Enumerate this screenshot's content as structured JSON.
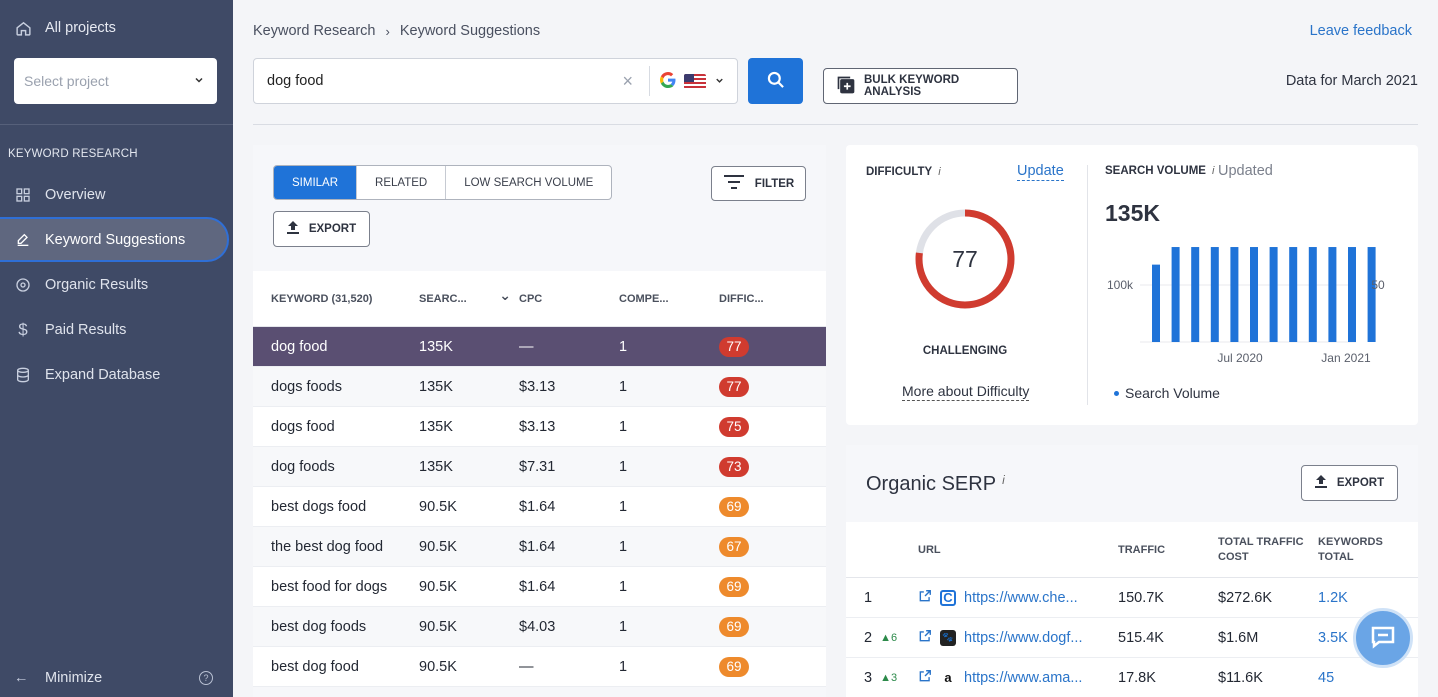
{
  "sidebar": {
    "all_projects": "All projects",
    "select_project_placeholder": "Select project",
    "section_title": "KEYWORD RESEARCH",
    "items": [
      {
        "label": "Overview",
        "icon": "grid-icon"
      },
      {
        "label": "Keyword Suggestions",
        "icon": "pencil-icon",
        "active": true
      },
      {
        "label": "Organic Results",
        "icon": "target-icon"
      },
      {
        "label": "Paid Results",
        "icon": "dollar-icon"
      },
      {
        "label": "Expand Database",
        "icon": "database-icon"
      }
    ],
    "minimize": "Minimize"
  },
  "header": {
    "breadcrumb": [
      "Keyword Research",
      "Keyword Suggestions"
    ],
    "feedback": "Leave feedback",
    "search_value": "dog food",
    "bulk_label": "BULK KEYWORD ANALYSIS",
    "data_for": "Data for March 2021"
  },
  "keywords": {
    "tabs": [
      "SIMILAR",
      "RELATED",
      "LOW SEARCH VOLUME"
    ],
    "filter_label": "FILTER",
    "export_label": "EXPORT",
    "columns": {
      "keyword": "KEYWORD  (31,520)",
      "search": "SEARC...",
      "cpc": "CPC",
      "competition": "COMPE...",
      "difficulty": "DIFFIC..."
    },
    "rows": [
      {
        "keyword": "dog food",
        "search": "135K",
        "cpc": "—",
        "competition": "1",
        "difficulty": "77"
      },
      {
        "keyword": "dogs foods",
        "search": "135K",
        "cpc": "$3.13",
        "competition": "1",
        "difficulty": "77"
      },
      {
        "keyword": "dogs food",
        "search": "135K",
        "cpc": "$3.13",
        "competition": "1",
        "difficulty": "75"
      },
      {
        "keyword": "dog foods",
        "search": "135K",
        "cpc": "$7.31",
        "competition": "1",
        "difficulty": "73"
      },
      {
        "keyword": "best dogs food",
        "search": "90.5K",
        "cpc": "$1.64",
        "competition": "1",
        "difficulty": "69"
      },
      {
        "keyword": "the best dog food",
        "search": "90.5K",
        "cpc": "$1.64",
        "competition": "1",
        "difficulty": "67"
      },
      {
        "keyword": "best food for dogs",
        "search": "90.5K",
        "cpc": "$1.64",
        "competition": "1",
        "difficulty": "69"
      },
      {
        "keyword": "best dog foods",
        "search": "90.5K",
        "cpc": "$4.03",
        "competition": "1",
        "difficulty": "69"
      },
      {
        "keyword": "best dog food",
        "search": "90.5K",
        "cpc": "—",
        "competition": "1",
        "difficulty": "69"
      }
    ]
  },
  "difficulty": {
    "title": "DIFFICULTY",
    "info": "i",
    "update": "Update",
    "value": "77",
    "score": 77,
    "label": "CHALLENGING",
    "more": "More about Difficulty",
    "color": "#d03b2f"
  },
  "search_volume": {
    "title": "SEARCH VOLUME",
    "info": "i",
    "updated": "Updated",
    "value": "135K",
    "legend": "Search Volume"
  },
  "chart_data": {
    "type": "bar",
    "values": [
      110,
      135,
      135,
      135,
      135,
      135,
      135,
      135,
      135,
      135,
      135,
      135
    ],
    "y_left_label": "100k",
    "y_right_label": "50",
    "x_tick_labels": [
      "Jul 2020",
      "Jan 2021"
    ],
    "legend": "Search Volume",
    "color": "#1f73d8"
  },
  "serp": {
    "title": "Organic SERP",
    "info": "i",
    "export_label": "EXPORT",
    "columns": {
      "url": "URL",
      "traffic": "TRAFFIC",
      "cost": "TOTAL TRAFFIC COST",
      "keywords": "KEYWORDS TOTAL"
    },
    "rows": [
      {
        "pos": "1",
        "delta": "",
        "url": "https://www.che...",
        "traffic": "150.7K",
        "cost": "$272.6K",
        "keywords": "1.2K"
      },
      {
        "pos": "2",
        "delta": "▲6",
        "url": "https://www.dogf...",
        "traffic": "515.4K",
        "cost": "$1.6M",
        "keywords": "3.5K"
      },
      {
        "pos": "3",
        "delta": "▲3",
        "url": "https://www.ama...",
        "traffic": "17.8K",
        "cost": "$11.6K",
        "keywords": "45"
      }
    ]
  }
}
